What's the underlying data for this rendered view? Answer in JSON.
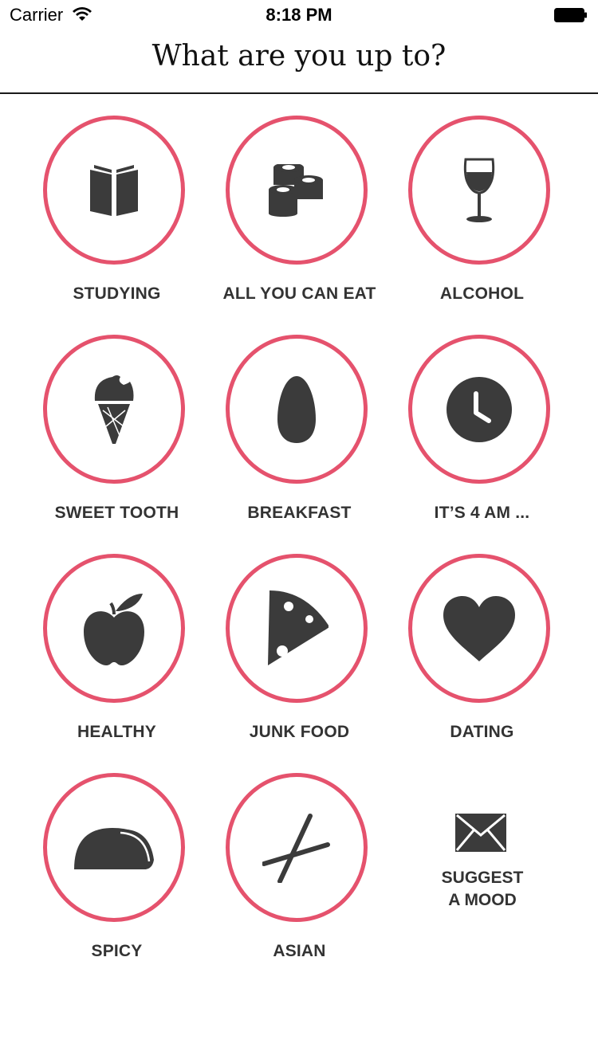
{
  "status_bar": {
    "carrier": "Carrier",
    "time": "8:18 PM"
  },
  "header": {
    "title": "What are you up to?"
  },
  "accent_color": "#e5526d",
  "icon_color": "#3b3b3b",
  "moods": [
    {
      "label": "STUDYING",
      "icon": "book-icon"
    },
    {
      "label": "ALL YOU CAN EAT",
      "icon": "sushi-icon"
    },
    {
      "label": "ALCOHOL",
      "icon": "wine-glass-icon"
    },
    {
      "label": "SWEET TOOTH",
      "icon": "ice-cream-icon"
    },
    {
      "label": "BREAKFAST",
      "icon": "egg-icon"
    },
    {
      "label": "IT’S 4 AM ...",
      "icon": "clock-icon"
    },
    {
      "label": "HEALTHY",
      "icon": "apple-icon"
    },
    {
      "label": "JUNK FOOD",
      "icon": "pizza-icon"
    },
    {
      "label": "DATING",
      "icon": "heart-icon"
    },
    {
      "label": "SPICY",
      "icon": "taco-icon"
    },
    {
      "label": "ASIAN",
      "icon": "chopsticks-icon"
    }
  ],
  "suggest": {
    "line1": "SUGGEST",
    "line2": "A MOOD",
    "icon": "envelope-icon"
  }
}
